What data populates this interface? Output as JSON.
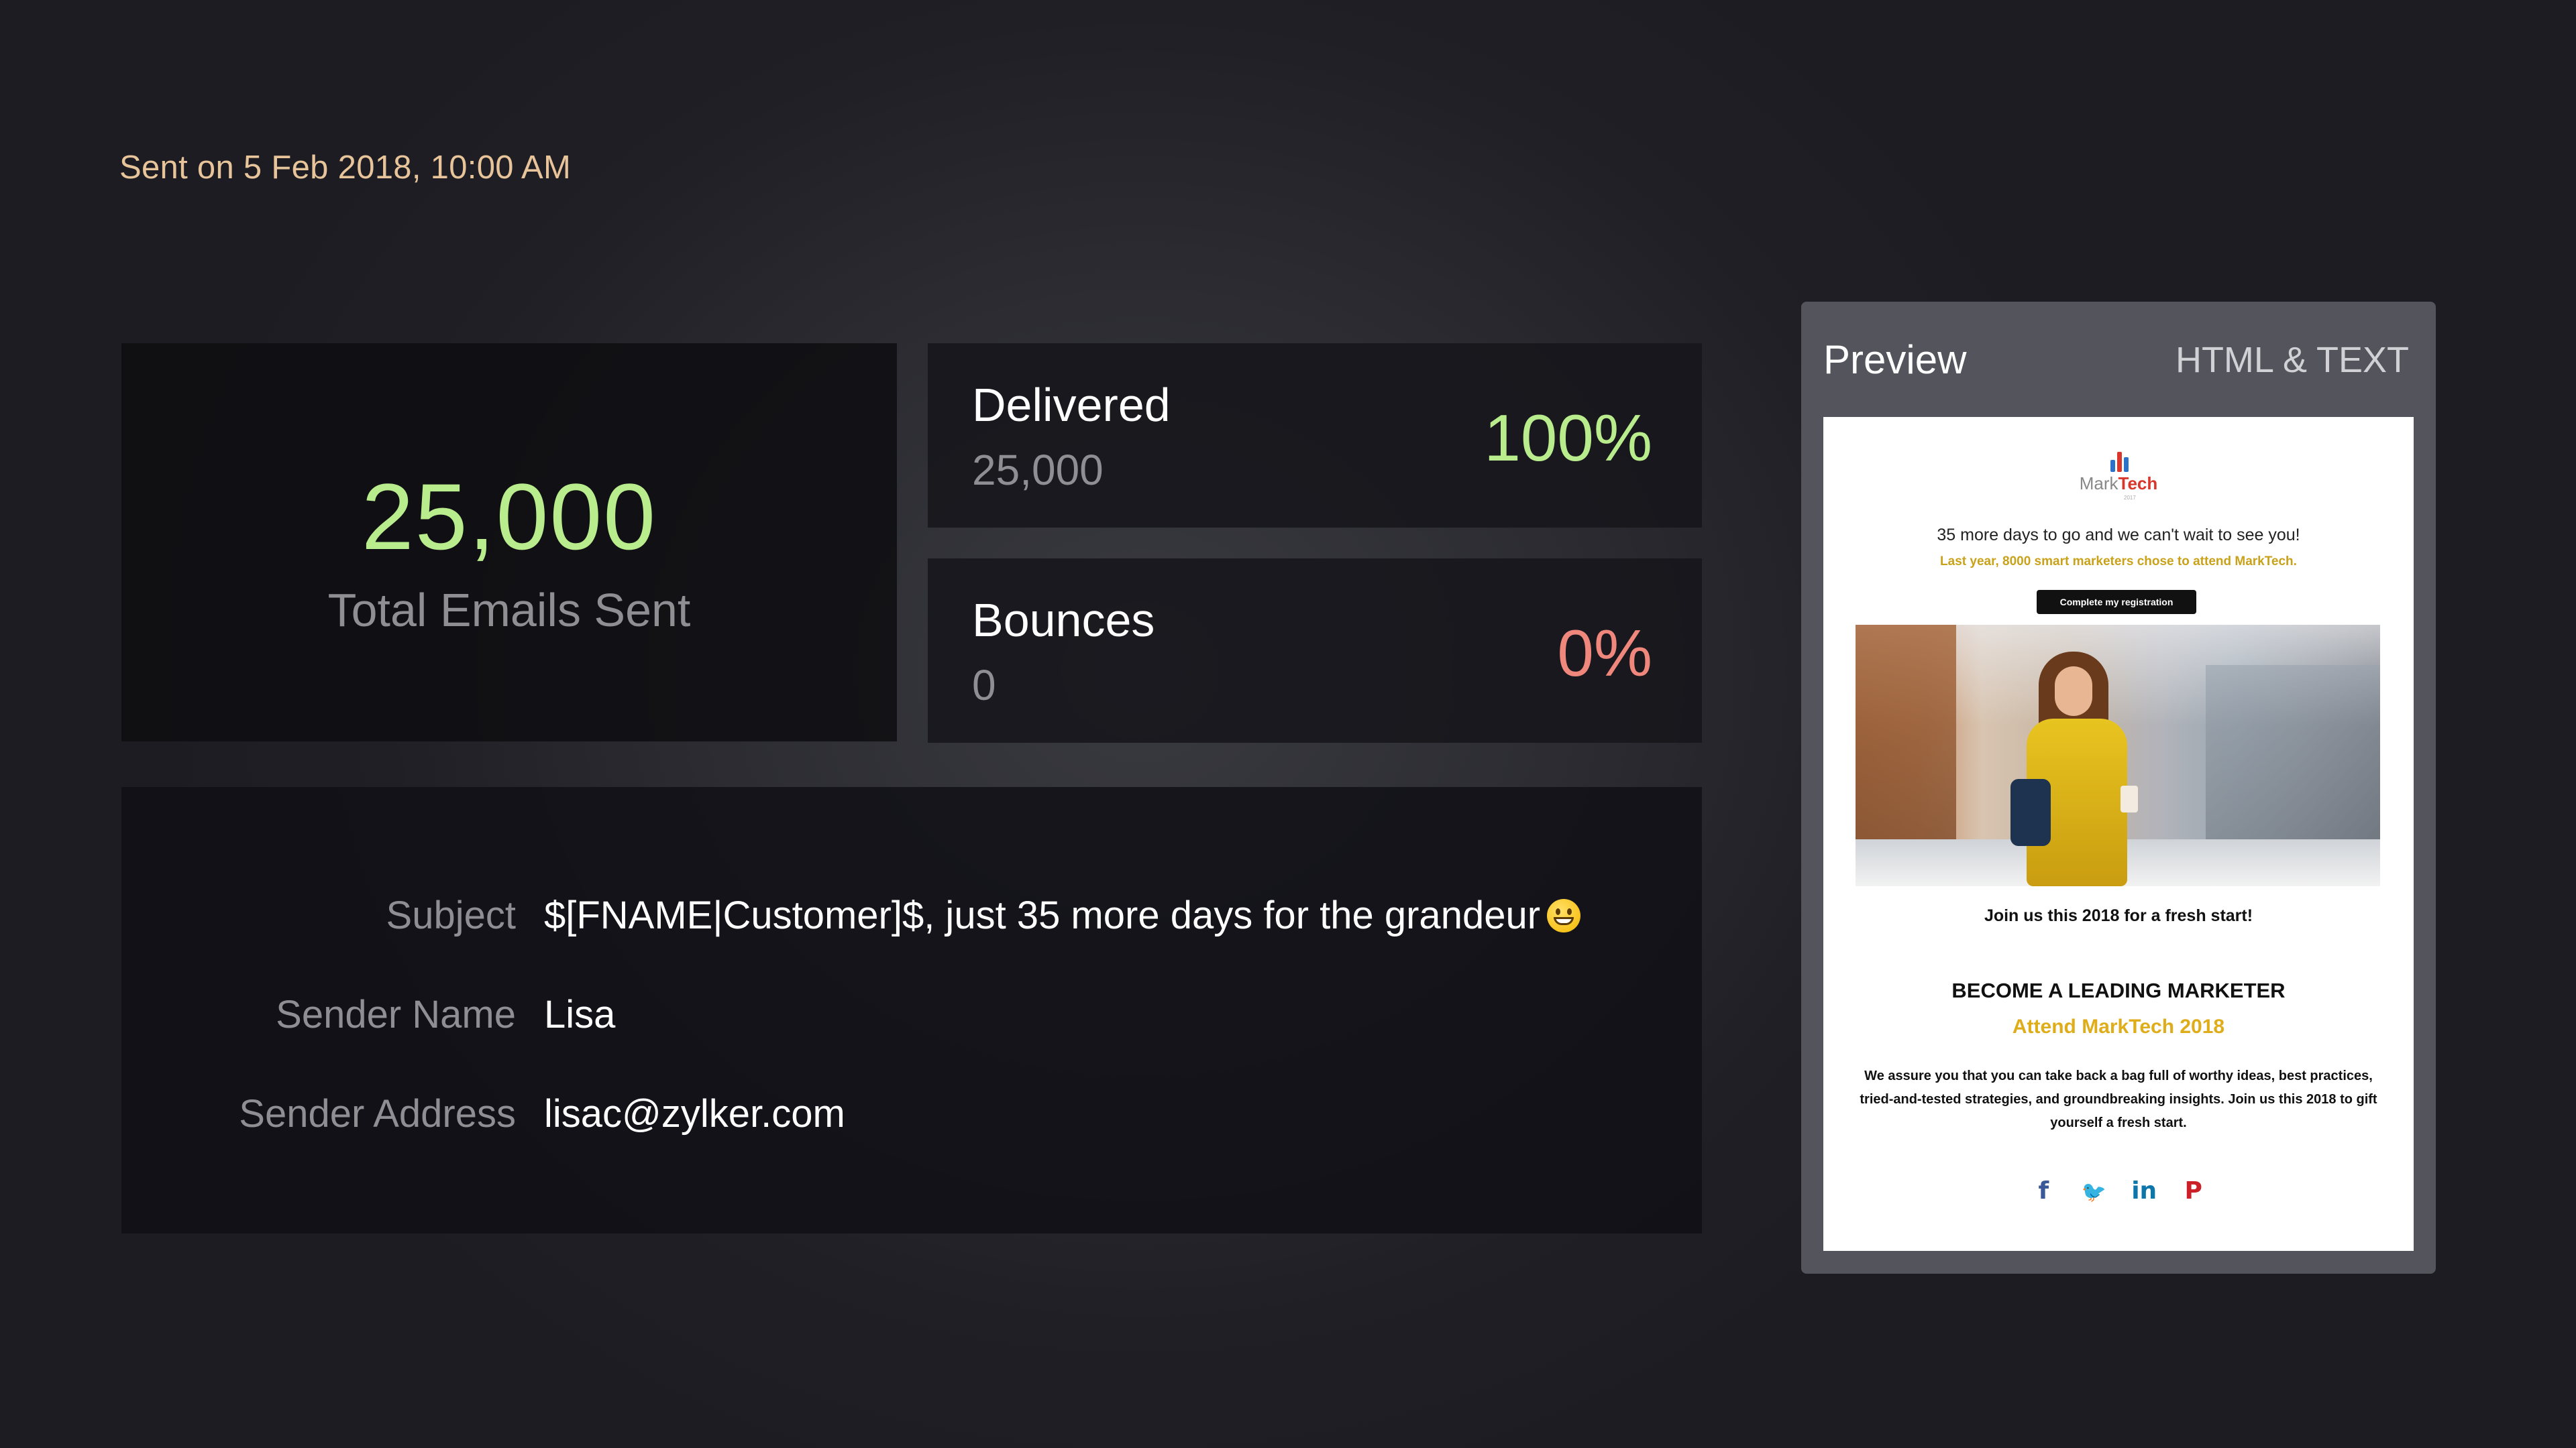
{
  "header": {
    "sent_on": "Sent on 5 Feb 2018, 10:00 AM"
  },
  "stats": {
    "total": {
      "value": "25,000",
      "label": "Total Emails Sent"
    },
    "delivered": {
      "title": "Delivered",
      "count": "25,000",
      "percent": "100%"
    },
    "bounces": {
      "title": "Bounces",
      "count": "0",
      "percent": "0%"
    }
  },
  "details": {
    "subject_label": "Subject",
    "subject_value": "$[FNAME|Customer]$, just 35 more days for the grandeur",
    "sender_name_label": "Sender Name",
    "sender_name_value": "Lisa",
    "sender_address_label": "Sender Address",
    "sender_address_value": "lisac@zylker.com"
  },
  "preview": {
    "title": "Preview",
    "mode": "HTML & TEXT",
    "email": {
      "logo_prefix": "Mark",
      "logo_suffix": "Tech",
      "logo_year": "2017",
      "line1": "35 more days to go and we can't wait to see you!",
      "line2": "Last year, 8000 smart marketers chose to attend MarkTech.",
      "cta": "Complete my registration",
      "tagline": "Join us this 2018 for a fresh start!",
      "heading": "BECOME A LEADING MARKETER",
      "subheading": "Attend MarkTech 2018",
      "body": "We assure you that you can take back a bag full of worthy ideas, best practices, tried-and-tested strategies, and groundbreaking insights. Join us this 2018 to gift yourself a fresh start.",
      "social": {
        "facebook": "f",
        "twitter": "🐦",
        "linkedin": "in",
        "pinterest": "P"
      }
    }
  },
  "colors": {
    "accent_green": "#b9ec8c",
    "accent_red": "#f0877c",
    "date_color": "#e8c49a",
    "subheading_gold": "#e0ad1a"
  },
  "icons": {
    "subject_emoji": "grinning-face-icon"
  }
}
